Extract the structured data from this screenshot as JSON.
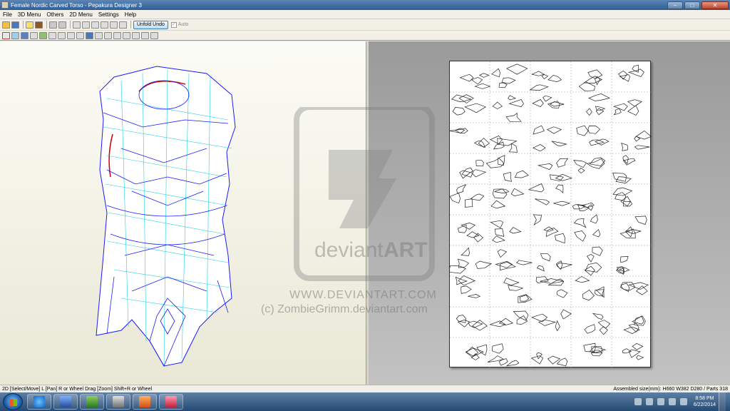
{
  "window": {
    "title": "Female Nordic Carved Torso - Pepakura Designer 3",
    "controls": {
      "minimize": "–",
      "maximize": "□",
      "close": "✕"
    }
  },
  "menubar": {
    "items": [
      "File",
      "3D Menu",
      "Others",
      "2D Menu",
      "Settings",
      "Help"
    ]
  },
  "toolbar": {
    "unfold_undo_label": "Unfold Undo",
    "auto_label": "Auto",
    "auto_checked": "✓"
  },
  "watermark": {
    "url": "WWW.DEVIANTART.COM",
    "credit": "(c) ZombieGrimm.deviantart.com"
  },
  "status": {
    "left": "2D [Select/Move] L [Pan] R or Wheel Drag [Zoom] Shift+R or Wheel",
    "right": "Assembled size(mm): H660 W382 D280 / Parts 318"
  },
  "taskbar": {
    "apps": [
      "internet-explorer",
      "virtualbox",
      "game",
      "media-center",
      "apps-store",
      "pepakura"
    ],
    "clock_time": "8:58 PM",
    "clock_date": "6/22/2014"
  },
  "colors": {
    "mesh_blue": "#1a1aff",
    "mesh_cyan": "#22d0e6",
    "edge_red": "#cc0000",
    "accent": "#3c7fb1"
  }
}
